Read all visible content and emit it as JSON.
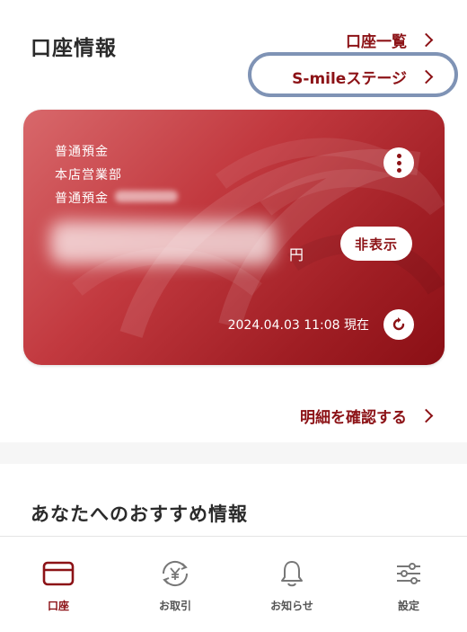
{
  "header": {
    "title": "口座情報",
    "account_list_link": "口座一覧",
    "smile_stage_link": "S-mileステージ"
  },
  "card": {
    "account_type": "普通預金",
    "branch": "本店営業部",
    "account_label": "普通預金",
    "currency": "円",
    "hide_label": "非表示",
    "timestamp": "2024.04.03 11:08 現在"
  },
  "statement_link": "明細を確認する",
  "recommend": {
    "title": "あなたへのおすすめ情報"
  },
  "nav": {
    "items": [
      {
        "label": "口座",
        "icon": "card-icon"
      },
      {
        "label": "お取引",
        "icon": "yen-exchange-icon"
      },
      {
        "label": "お知らせ",
        "icon": "bell-icon"
      },
      {
        "label": "設定",
        "icon": "sliders-icon"
      }
    ],
    "active_index": 0
  },
  "colors": {
    "brand": "#8c1216",
    "card_start": "#d8686b",
    "card_end": "#8a0f15",
    "highlight_ring": "#7f93b5"
  }
}
